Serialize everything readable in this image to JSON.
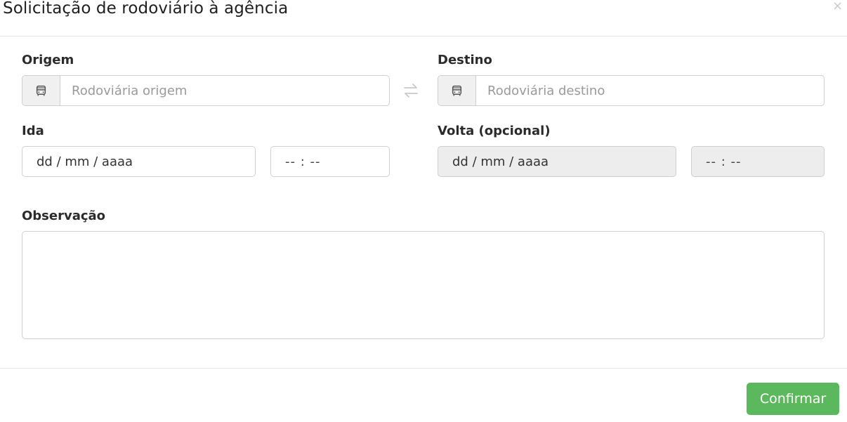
{
  "modal": {
    "title": "Solicitação de rodoviário à agência",
    "close_icon": "×"
  },
  "origin": {
    "label": "Origem",
    "icon": "bus-icon",
    "placeholder": "Rodoviária origem"
  },
  "swap": {
    "icon": "swap-arrows-icon"
  },
  "destination": {
    "label": "Destino",
    "icon": "bus-icon",
    "placeholder": "Rodoviária destino"
  },
  "departure": {
    "label": "Ida",
    "date_placeholder": "dd / mm / aaaa",
    "time_placeholder": "-- : --"
  },
  "return": {
    "label": "Volta (opcional)",
    "date_placeholder": "dd / mm / aaaa",
    "time_placeholder": "-- : --",
    "disabled": true
  },
  "notes": {
    "label": "Observação",
    "value": ""
  },
  "footer": {
    "confirm_label": "Confirmar"
  },
  "colors": {
    "confirm_bg": "#5cb85c",
    "disabled_bg": "#ededed",
    "border": "#cfcfcf"
  }
}
